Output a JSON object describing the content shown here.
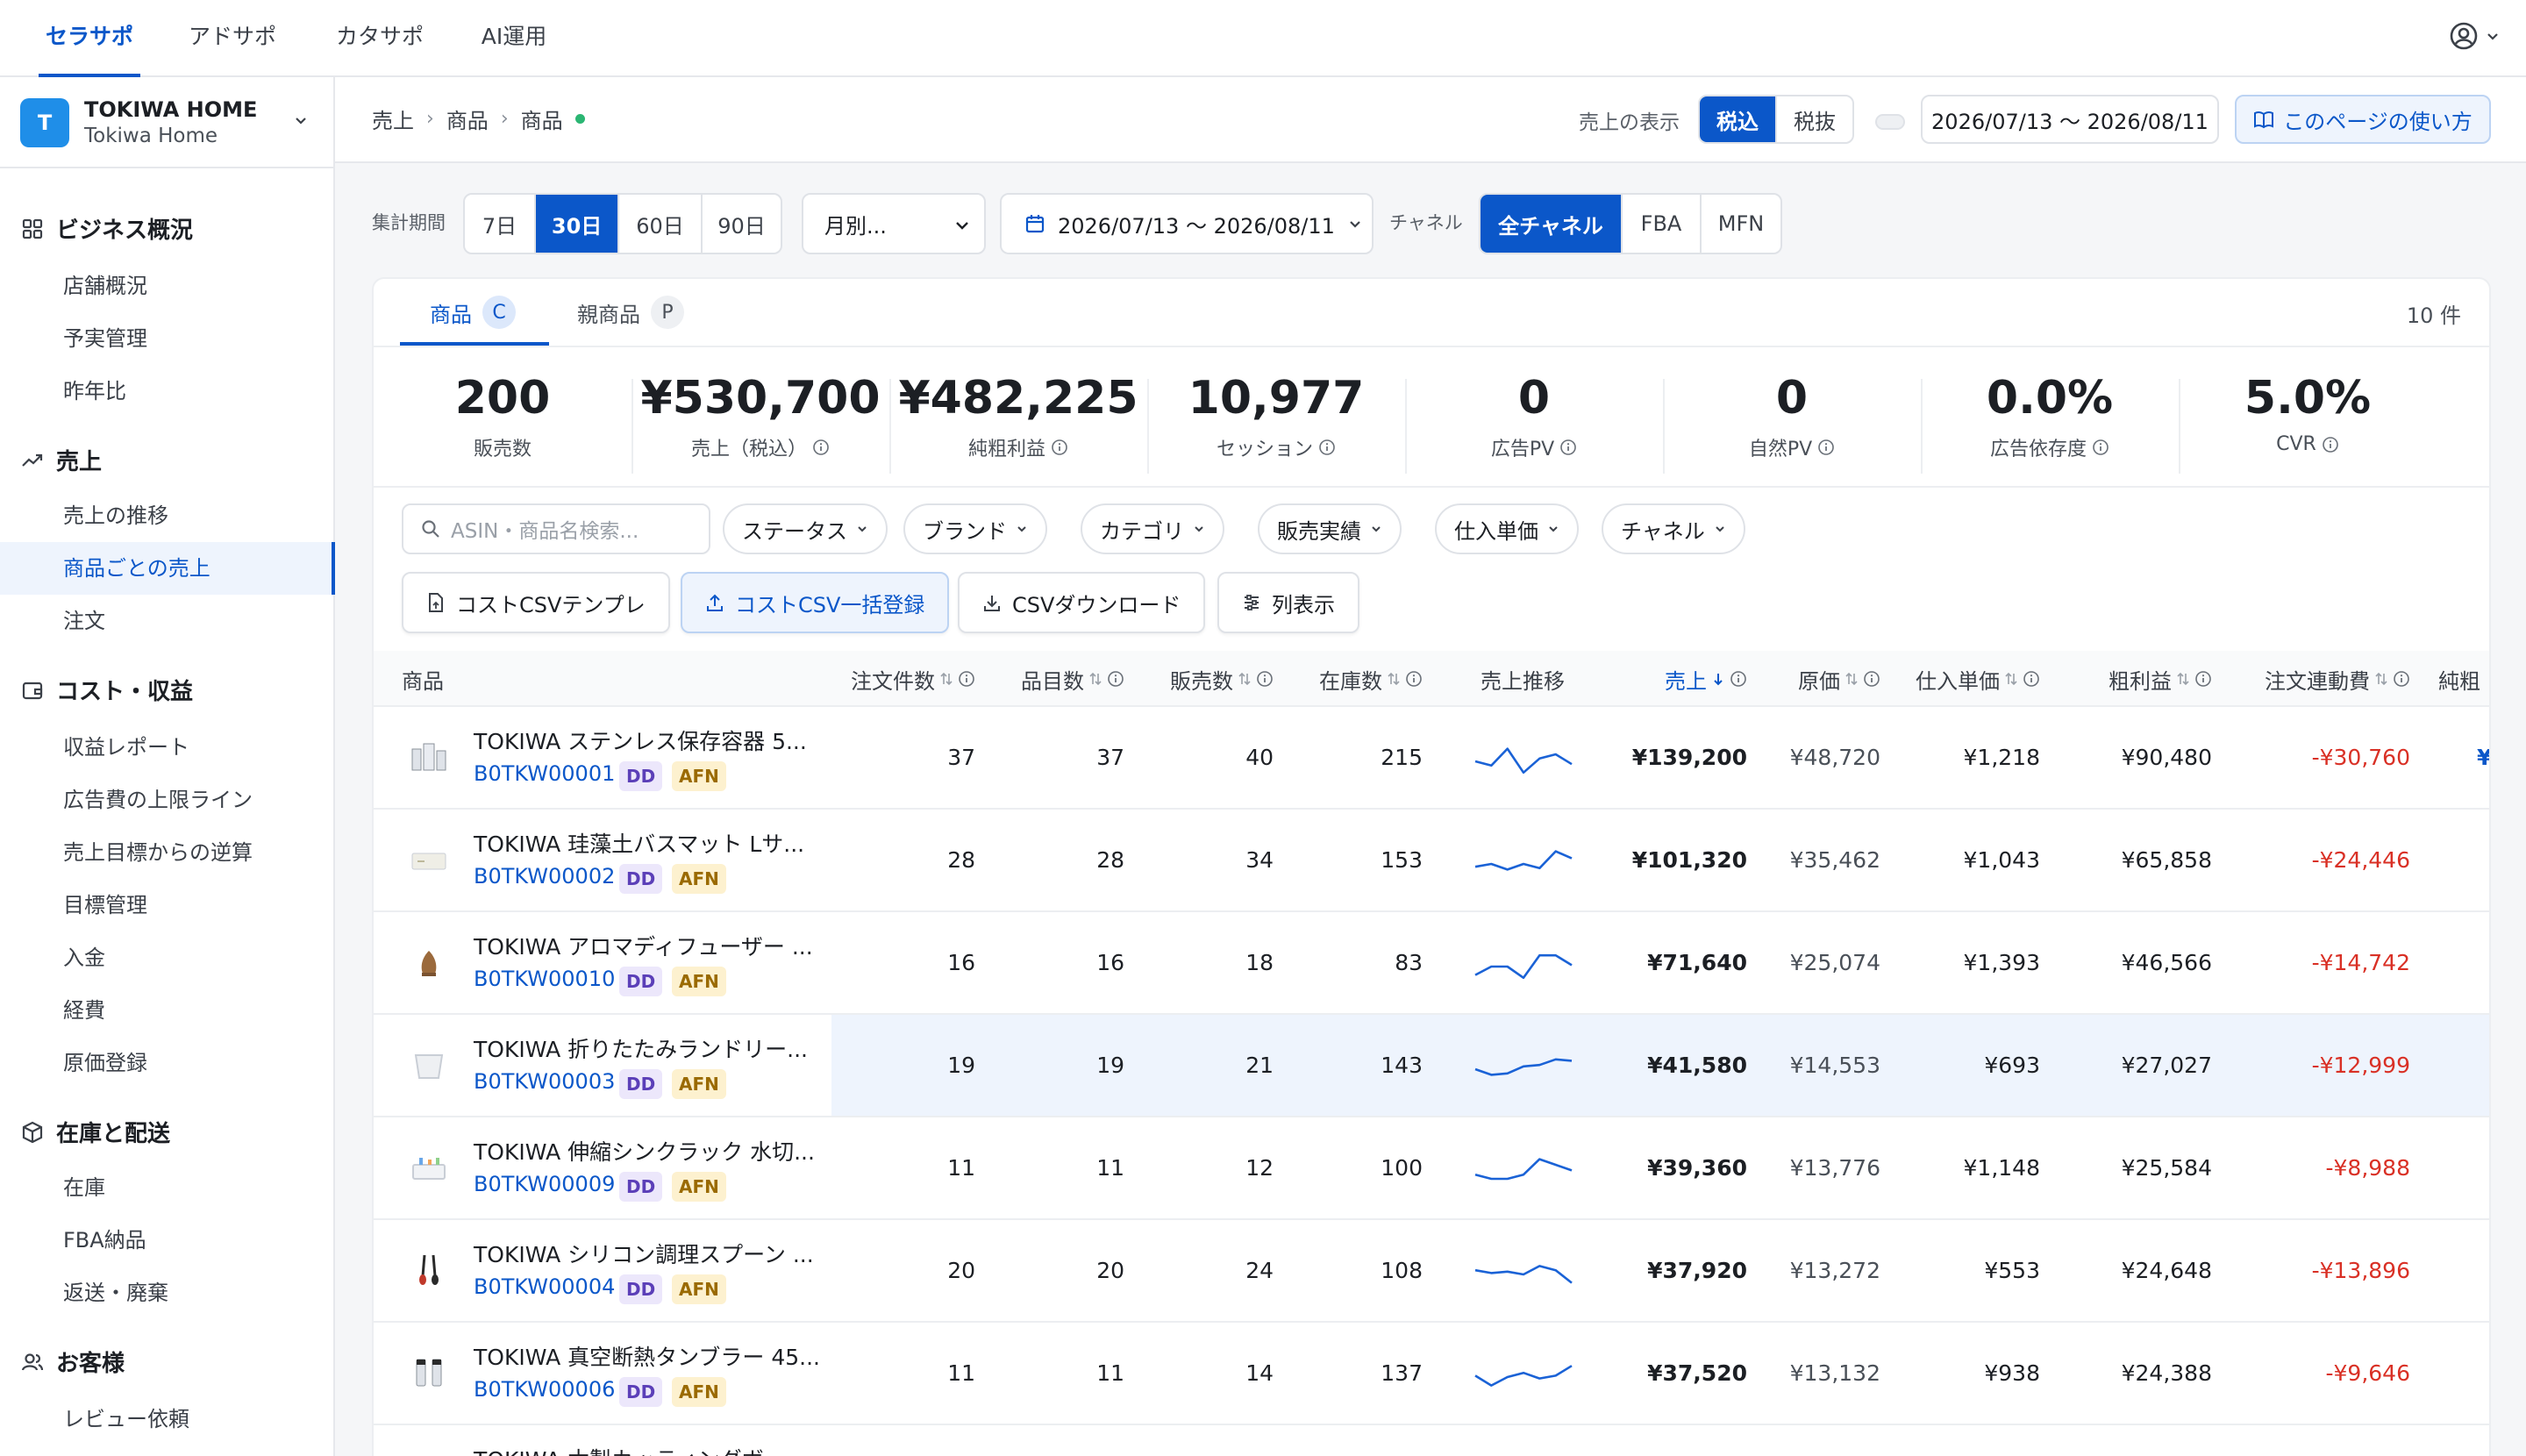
{
  "top_nav": {
    "tabs": [
      {
        "label": "セラサポ",
        "active": true
      },
      {
        "label": "アドサポ",
        "active": false
      },
      {
        "label": "カタサポ",
        "active": false
      },
      {
        "label": "AI運用",
        "active": false
      }
    ],
    "user_icon": "user-circle-icon"
  },
  "shop": {
    "avatar_letter": "T",
    "name": "TOKIWA HOME",
    "sub": "Tokiwa Home"
  },
  "sidebar": {
    "groups": [
      {
        "title": "ビジネス概況",
        "icon": "grid-icon",
        "items": [
          "店舗概況",
          "予実管理",
          "昨年比"
        ]
      },
      {
        "title": "売上",
        "icon": "trend-icon",
        "items": [
          "売上の推移",
          "商品ごとの売上",
          "注文"
        ]
      },
      {
        "title": "コスト・収益",
        "icon": "wallet-icon",
        "items": [
          "収益レポート",
          "広告費の上限ライン",
          "売上目標からの逆算",
          "目標管理",
          "入金",
          "経費",
          "原価登録"
        ]
      },
      {
        "title": "在庫と配送",
        "icon": "box-icon",
        "items": [
          "在庫",
          "FBA納品",
          "返送・廃棄"
        ]
      },
      {
        "title": "お客様",
        "icon": "users-icon",
        "items": [
          "レビュー依頼"
        ]
      }
    ],
    "active_item": "商品ごとの売上"
  },
  "breadcrumb": [
    "売上",
    "商品",
    "商品"
  ],
  "header": {
    "tax_label": "売上の表示",
    "tax_options": [
      "税込",
      "税抜"
    ],
    "tax_selected": "税込",
    "date_range": "2026/07/13 〜 2026/08/11",
    "guide_button": "このページの使い方"
  },
  "filters": {
    "period_label": "集計期間",
    "period_options": [
      "7日",
      "30日",
      "60日",
      "90日"
    ],
    "period_selected": "30日",
    "granularity_value": "月別...",
    "date_range": "2026/07/13 〜 2026/08/11",
    "channel_label": "チャネル",
    "channel_options": [
      "全チャネル",
      "FBA",
      "MFN"
    ],
    "channel_selected": "全チャネル"
  },
  "card": {
    "tabs": [
      {
        "label": "商品",
        "badge": "C",
        "active": true
      },
      {
        "label": "親商品",
        "badge": "P",
        "active": false
      }
    ],
    "count": "10 件",
    "kpis": [
      {
        "value": "200",
        "label": "販売数",
        "info": false
      },
      {
        "value": "¥530,700",
        "label": "売上（税込）",
        "info": true
      },
      {
        "value": "¥482,225",
        "label": "純粗利益",
        "info": true
      },
      {
        "value": "10,977",
        "label": "セッション",
        "info": true
      },
      {
        "value": "0",
        "label": "広告PV",
        "info": true
      },
      {
        "value": "0",
        "label": "自然PV",
        "info": true
      },
      {
        "value": "0.0%",
        "label": "広告依存度",
        "info": true
      },
      {
        "value": "5.0%",
        "label": "CVR",
        "info": true
      }
    ],
    "search_placeholder": "ASIN・商品名検索...",
    "filter_chips": [
      "ステータス",
      "ブランド",
      "カテゴリ",
      "販売実績",
      "仕入単価",
      "チャネル"
    ],
    "actions": [
      "コストCSVテンプレ",
      "コストCSV一括登録",
      "CSVダウンロード",
      "列表示"
    ]
  },
  "table": {
    "columns": [
      "商品",
      "注文件数",
      "品目数",
      "販売数",
      "在庫数",
      "売上推移",
      "売上",
      "原価",
      "仕入単価",
      "粗利益",
      "注文連動費",
      "純粗"
    ],
    "sorted_column": "売上",
    "rows": [
      {
        "name": "TOKIWA ステンレス保存容器 5...",
        "asin": "B0TKW00001",
        "tags": [
          "DD",
          "AFN"
        ],
        "orders": "37",
        "items": "37",
        "units": "40",
        "stock": "215",
        "sales": "¥139,200",
        "cost": "¥48,720",
        "unit_cost": "¥1,218",
        "gross": "¥90,480",
        "fees": "-¥30,760",
        "trend": [
          3,
          3.6,
          1.2,
          4.6,
          2.6,
          2.0,
          3.4
        ],
        "thumb": "container"
      },
      {
        "name": "TOKIWA 珪藻土バスマット Lサ...",
        "asin": "B0TKW00002",
        "tags": [
          "DD",
          "AFN"
        ],
        "orders": "28",
        "items": "28",
        "units": "34",
        "stock": "153",
        "sales": "¥101,320",
        "cost": "¥35,462",
        "unit_cost": "¥1,043",
        "gross": "¥65,858",
        "fees": "-¥24,446",
        "trend": [
          3.4,
          3.0,
          3.8,
          3.0,
          3.6,
          1.2,
          2.2
        ],
        "thumb": "mat"
      },
      {
        "name": "TOKIWA アロマディフューザー ...",
        "asin": "B0TKW00010",
        "tags": [
          "DD",
          "AFN"
        ],
        "orders": "16",
        "items": "16",
        "units": "18",
        "stock": "83",
        "sales": "¥71,640",
        "cost": "¥25,074",
        "unit_cost": "¥1,393",
        "gross": "¥46,566",
        "fees": "-¥14,742",
        "trend": [
          4.2,
          3.0,
          3.0,
          4.6,
          1.4,
          1.4,
          2.8
        ],
        "thumb": "diffuser"
      },
      {
        "name": "TOKIWA 折りたたみランドリー...",
        "asin": "B0TKW00003",
        "tags": [
          "DD",
          "AFN"
        ],
        "orders": "19",
        "items": "19",
        "units": "21",
        "stock": "143",
        "sales": "¥41,580",
        "cost": "¥14,553",
        "unit_cost": "¥693",
        "gross": "¥27,027",
        "fees": "-¥12,999",
        "trend": [
          3.0,
          3.8,
          3.6,
          2.6,
          2.4,
          1.6,
          1.8
        ],
        "thumb": "basket"
      },
      {
        "name": "TOKIWA 伸縮シンクラック 水切...",
        "asin": "B0TKW00009",
        "tags": [
          "DD",
          "AFN"
        ],
        "orders": "11",
        "items": "11",
        "units": "12",
        "stock": "100",
        "sales": "¥39,360",
        "cost": "¥13,776",
        "unit_cost": "¥1,148",
        "gross": "¥25,584",
        "fees": "-¥8,988",
        "trend": [
          3.4,
          4.0,
          4.0,
          3.4,
          1.2,
          2.0,
          2.8
        ],
        "thumb": "rack"
      },
      {
        "name": "TOKIWA シリコン調理スプーン ...",
        "asin": "B0TKW00004",
        "tags": [
          "DD",
          "AFN"
        ],
        "orders": "20",
        "items": "20",
        "units": "24",
        "stock": "108",
        "sales": "¥37,920",
        "cost": "¥13,272",
        "unit_cost": "¥553",
        "gross": "¥24,648",
        "fees": "-¥13,896",
        "trend": [
          2.4,
          2.8,
          2.6,
          3.0,
          1.8,
          2.4,
          4.2
        ],
        "thumb": "spoon"
      },
      {
        "name": "TOKIWA 真空断熱タンブラー 45...",
        "asin": "B0TKW00006",
        "tags": [
          "DD",
          "AFN"
        ],
        "orders": "11",
        "items": "11",
        "units": "14",
        "stock": "137",
        "sales": "¥37,520",
        "cost": "¥13,132",
        "unit_cost": "¥938",
        "gross": "¥24,388",
        "fees": "-¥9,646",
        "trend": [
          2.8,
          4.2,
          3.0,
          2.4,
          3.2,
          2.8,
          1.4
        ],
        "thumb": "tumbler"
      },
      {
        "name": "TOKIWA 木製カッティングボー...",
        "asin": "",
        "tags": [],
        "orders": "",
        "items": "",
        "units": "",
        "stock": "",
        "sales": "",
        "cost": "",
        "unit_cost": "",
        "gross": "",
        "fees": "",
        "trend": [],
        "thumb": "board"
      }
    ]
  },
  "colors": {
    "accent": "#0b57c9",
    "negative": "#d93025",
    "spark": "#1a62d6"
  }
}
